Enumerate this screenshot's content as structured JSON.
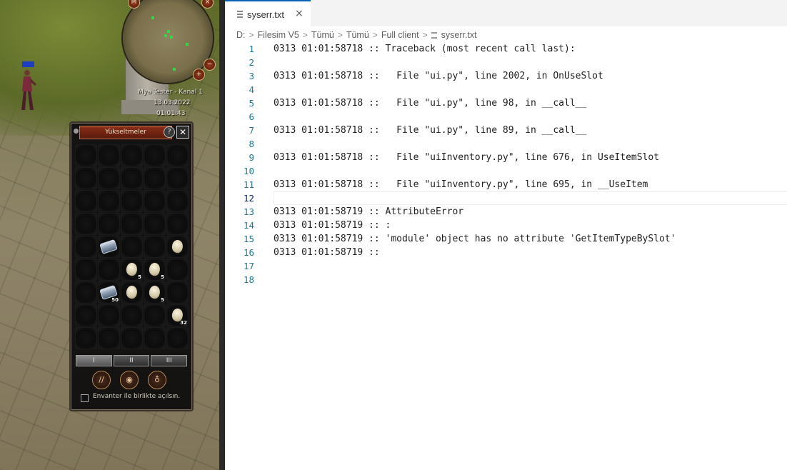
{
  "game": {
    "minimap": {
      "buttons": {
        "m": "M",
        "close": "×",
        "zoom_in": "+",
        "zoom_out": "−"
      },
      "player_name": "Mya Tester - Kanal 1",
      "date": "13.03.2022",
      "time": "01:01:43"
    },
    "inventory": {
      "title": "Yükseltmeler",
      "help": "?",
      "close": "✕",
      "tabs": [
        "I",
        "II",
        "III"
      ],
      "checkbox_label": "Envanter ile birlikte açılsın.",
      "counts": {
        "c1": "5",
        "c2": "5",
        "c3": "50",
        "c4": "5",
        "c5": "32"
      }
    }
  },
  "editor": {
    "tab": {
      "label": "syserr.txt",
      "close": "×"
    },
    "breadcrumb": [
      "D:",
      "Filesim V5",
      "Tümü",
      "Tümü",
      "Full client",
      "syserr.txt"
    ],
    "lines": [
      {
        "n": "1",
        "t": "0313 01:01:58718 :: Traceback (most recent call last):"
      },
      {
        "n": "2",
        "t": ""
      },
      {
        "n": "3",
        "t": "0313 01:01:58718 ::   File \"ui.py\", line 2002, in OnUseSlot"
      },
      {
        "n": "4",
        "t": ""
      },
      {
        "n": "5",
        "t": "0313 01:01:58718 ::   File \"ui.py\", line 98, in __call__"
      },
      {
        "n": "6",
        "t": ""
      },
      {
        "n": "7",
        "t": "0313 01:01:58718 ::   File \"ui.py\", line 89, in __call__"
      },
      {
        "n": "8",
        "t": ""
      },
      {
        "n": "9",
        "t": "0313 01:01:58718 ::   File \"uiInventory.py\", line 676, in UseItemSlot"
      },
      {
        "n": "10",
        "t": ""
      },
      {
        "n": "11",
        "t": "0313 01:01:58718 ::   File \"uiInventory.py\", line 695, in __UseItem"
      },
      {
        "n": "12",
        "t": ""
      },
      {
        "n": "13",
        "t": "0313 01:01:58719 :: AttributeError"
      },
      {
        "n": "14",
        "t": "0313 01:01:58719 :: :"
      },
      {
        "n": "15",
        "t": "0313 01:01:58719 :: 'module' object has no attribute 'GetItemTypeBySlot'"
      },
      {
        "n": "16",
        "t": "0313 01:01:58719 :: "
      },
      {
        "n": "17",
        "t": ""
      },
      {
        "n": "18",
        "t": ""
      }
    ]
  }
}
